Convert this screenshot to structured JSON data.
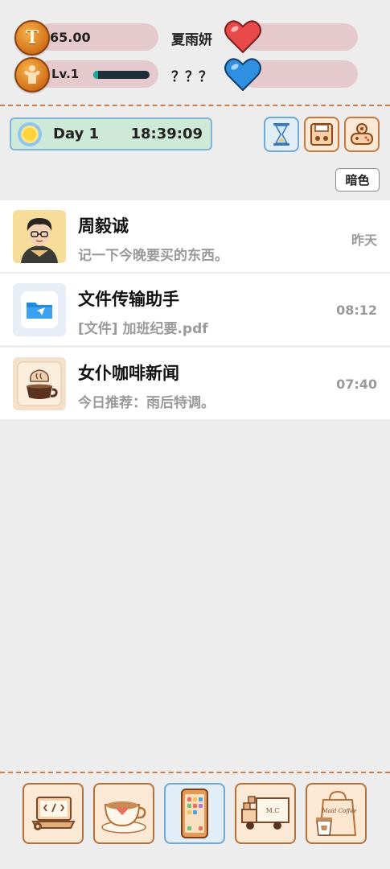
{
  "status": {
    "coins": "65.00",
    "level": "Lv.1",
    "xp_progress": 0.08,
    "character1": "夏雨妍",
    "character2": "？？？"
  },
  "day_panel": {
    "day": "Day 1",
    "time": "18:39:09"
  },
  "toolbar": {
    "theme_label": "暗色"
  },
  "chats": [
    {
      "name": "周毅诚",
      "preview": "记一下今晚要买的东西。",
      "time": "昨天"
    },
    {
      "name": "文件传输助手",
      "preview": "[文件] 加班纪要.pdf",
      "time": "08:12"
    },
    {
      "name": "女仆咖啡新闻",
      "preview": "今日推荐：雨后特调。",
      "time": "07:40"
    }
  ],
  "nav": {
    "items": [
      "code-laptop",
      "coffee-cup",
      "smartphone",
      "moving-truck",
      "maid-coffee-bag"
    ],
    "active": "smartphone",
    "truck_text": "M.C",
    "bag_text": "Maid Coffee"
  },
  "colors": {
    "background": "#ededee",
    "bar": "#e6c9cd",
    "accent_orange": "#c17a44",
    "accent_blue": "#6fa9d6",
    "day_panel": "#cfe9d9",
    "heart_red": "#e84a4a",
    "heart_blue": "#2f8fe0"
  }
}
